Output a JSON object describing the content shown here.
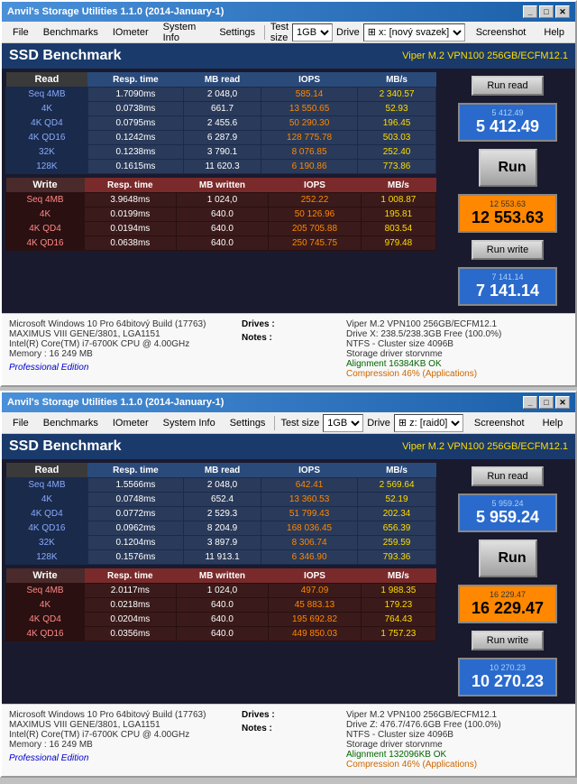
{
  "windows": [
    {
      "title": "Anvil's Storage Utilities 1.1.0 (2014-January-1)",
      "menu": [
        "File",
        "Benchmarks",
        "IOmeter",
        "System Info",
        "Settings"
      ],
      "testsize_label": "Test size",
      "testsize_value": "1GB",
      "drive_label": "Drive",
      "drive_value": "⊞ x: [nový svazek]",
      "screenshot_btn": "Screenshot",
      "help_btn": "Help",
      "ssd_title": "SSD Benchmark",
      "ssd_subtitle": "Viper M.2 VPN100 256GB/ECFM12.1",
      "run_label": "Run",
      "run_read_label": "Run read",
      "run_write_label": "Run write",
      "read_headers": [
        "Read",
        "Resp. time",
        "MB read",
        "IOPS",
        "MB/s"
      ],
      "read_rows": [
        [
          "Seq 4MB",
          "1.7090ms",
          "2 048,0",
          "585.14",
          "2 340.57"
        ],
        [
          "4K",
          "0.0738ms",
          "661.7",
          "13 550.65",
          "52.93"
        ],
        [
          "4K QD4",
          "0.0795ms",
          "2 455.6",
          "50 290.30",
          "196.45"
        ],
        [
          "4K QD16",
          "0.1242ms",
          "6 287.9",
          "128 775.78",
          "503.03"
        ],
        [
          "32K",
          "0.1238ms",
          "3 790.1",
          "8 076.85",
          "252.40"
        ],
        [
          "128K",
          "0.1615ms",
          "11 620.3",
          "6 190.86",
          "773.86"
        ]
      ],
      "write_headers": [
        "Write",
        "Resp. time",
        "MB written",
        "IOPS",
        "MB/s"
      ],
      "write_rows": [
        [
          "Seq 4MB",
          "3.9648ms",
          "1 024,0",
          "252.22",
          "1 008.87"
        ],
        [
          "4K",
          "0.0199ms",
          "640.0",
          "50 126.96",
          "195.81"
        ],
        [
          "4K QD4",
          "0.0194ms",
          "640.0",
          "205 705.88",
          "803.54"
        ],
        [
          "4K QD16",
          "0.0638ms",
          "640.0",
          "250 745.75",
          "979.48"
        ]
      ],
      "score_read_label": "5 412.49",
      "score_read_value": "5 412.49",
      "score_total_label": "12 553.63",
      "score_total_value": "12 553.63",
      "score_write_label": "7 141.14",
      "score_write_value": "7 141.14",
      "info_left": [
        "Microsoft Windows 10 Pro 64bitový Build (17763)",
        "MAXIMUS VIII GENE/3801, LGA1151",
        "Intel(R) Core(TM) i7-6700K CPU @ 4.00GHz",
        "Memory : 16 249 MB"
      ],
      "pro_edition": "Professional Edition",
      "drives_label": "Drives :",
      "notes_label": "Notes :",
      "info_right": [
        "Viper M.2 VPN100 256GB/ECFM12.1",
        "Drive X: 238.5/238.3GB Free (100.0%)",
        "NTFS - Cluster size 4096B",
        "Storage driver storvnme",
        "",
        "Alignment 16384KB OK",
        "Compression 46% (Applications)"
      ]
    },
    {
      "title": "Anvil's Storage Utilities 1.1.0 (2014-January-1)",
      "menu": [
        "File",
        "Benchmarks",
        "IOmeter",
        "System Info",
        "Settings"
      ],
      "testsize_label": "Test size",
      "testsize_value": "1GB",
      "drive_label": "Drive",
      "drive_value": "⊞ z: [raid0]",
      "screenshot_btn": "Screenshot",
      "help_btn": "Help",
      "ssd_title": "SSD Benchmark",
      "ssd_subtitle": "Viper M.2 VPN100 256GB/ECFM12.1",
      "run_label": "Run",
      "run_read_label": "Run read",
      "run_write_label": "Run write",
      "read_headers": [
        "Read",
        "Resp. time",
        "MB read",
        "IOPS",
        "MB/s"
      ],
      "read_rows": [
        [
          "Seq 4MB",
          "1.5566ms",
          "2 048,0",
          "642.41",
          "2 569.64"
        ],
        [
          "4K",
          "0.0748ms",
          "652.4",
          "13 360.53",
          "52.19"
        ],
        [
          "4K QD4",
          "0.0772ms",
          "2 529.3",
          "51 799.43",
          "202.34"
        ],
        [
          "4K QD16",
          "0.0962ms",
          "8 204.9",
          "168 036.45",
          "656.39"
        ],
        [
          "32K",
          "0.1204ms",
          "3 897.9",
          "8 306.74",
          "259.59"
        ],
        [
          "128K",
          "0.1576ms",
          "11 913.1",
          "6 346.90",
          "793.36"
        ]
      ],
      "write_headers": [
        "Write",
        "Resp. time",
        "MB written",
        "IOPS",
        "MB/s"
      ],
      "write_rows": [
        [
          "Seq 4MB",
          "2.0117ms",
          "1 024,0",
          "497.09",
          "1 988.35"
        ],
        [
          "4K",
          "0.0218ms",
          "640.0",
          "45 883.13",
          "179.23"
        ],
        [
          "4K QD4",
          "0.0204ms",
          "640.0",
          "195 692.82",
          "764.43"
        ],
        [
          "4K QD16",
          "0.0356ms",
          "640.0",
          "449 850.03",
          "1 757.23"
        ]
      ],
      "score_read_label": "5 959.24",
      "score_read_value": "5 959.24",
      "score_total_label": "16 229.47",
      "score_total_value": "16 229.47",
      "score_write_label": "10 270.23",
      "score_write_value": "10 270.23",
      "info_left": [
        "Microsoft Windows 10 Pro 64bitový Build (17763)",
        "MAXIMUS VIII GENE/3801, LGA1151",
        "Intel(R) Core(TM) i7-6700K CPU @ 4.00GHz",
        "Memory : 16 249 MB"
      ],
      "pro_edition": "Professional Edition",
      "drives_label": "Drives :",
      "notes_label": "Notes :",
      "info_right": [
        "Viper M.2 VPN100 256GB/ECFM12.1",
        "Drive Z: 476.7/476.6GB Free (100.0%)",
        "NTFS - Cluster size 4096B",
        "Storage driver storvnme",
        "",
        "Alignment 132096KB OK",
        "Compression 46% (Applications)"
      ]
    }
  ]
}
